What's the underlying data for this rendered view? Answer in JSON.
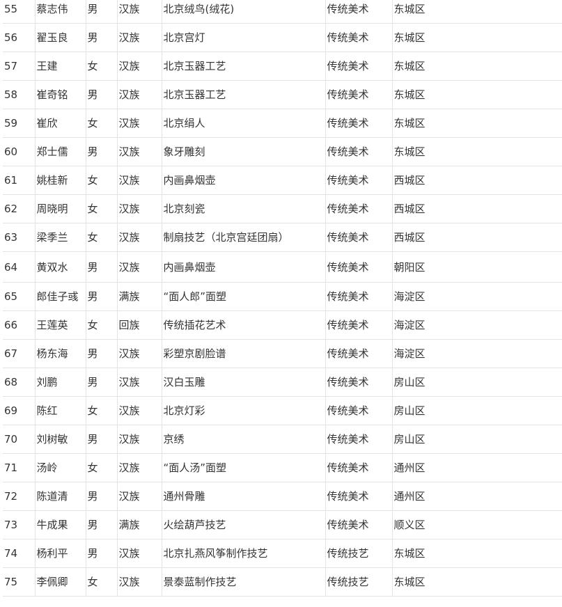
{
  "rows": [
    {
      "no": "55",
      "name": "蔡志伟",
      "gender": "男",
      "ethnic": "汉族",
      "project": "北京绒鸟(绒花)",
      "category": "传统美术",
      "district": "东城区"
    },
    {
      "no": "56",
      "name": "翟玉良",
      "gender": "男",
      "ethnic": "汉族",
      "project": "北京宫灯",
      "category": "传统美术",
      "district": "东城区"
    },
    {
      "no": "57",
      "name": "王建",
      "gender": "女",
      "ethnic": "汉族",
      "project": "北京玉器工艺",
      "category": "传统美术",
      "district": "东城区"
    },
    {
      "no": "58",
      "name": "崔奇铭",
      "gender": "男",
      "ethnic": "汉族",
      "project": "北京玉器工艺",
      "category": "传统美术",
      "district": "东城区"
    },
    {
      "no": "59",
      "name": "崔欣",
      "gender": "女",
      "ethnic": "汉族",
      "project": "北京绢人",
      "category": "传统美术",
      "district": "东城区"
    },
    {
      "no": "60",
      "name": "郑士儒",
      "gender": "男",
      "ethnic": "汉族",
      "project": "象牙雕刻",
      "category": "传统美术",
      "district": "东城区"
    },
    {
      "no": "61",
      "name": "姚桂新",
      "gender": "女",
      "ethnic": "汉族",
      "project": "内画鼻烟壶",
      "category": "传统美术",
      "district": "西城区"
    },
    {
      "no": "62",
      "name": "周晓明",
      "gender": "女",
      "ethnic": "汉族",
      "project": "北京刻瓷",
      "category": "传统美术",
      "district": "西城区"
    },
    {
      "no": "63",
      "name": "梁季兰",
      "gender": "女",
      "ethnic": "汉族",
      "project": "制扇技艺（北京宫廷团扇）",
      "category": "传统美术",
      "district": "西城区"
    },
    {
      "no": "64",
      "name": "黄双水",
      "gender": "男",
      "ethnic": "汉族",
      "project": "内画鼻烟壶",
      "category": "传统美术",
      "district": "朝阳区"
    },
    {
      "no": "65",
      "name": "郎佳子彧",
      "gender": "男",
      "ethnic": "满族",
      "project": "“面人郎”面塑",
      "category": "传统美术",
      "district": "海淀区"
    },
    {
      "no": "66",
      "name": "王莲英",
      "gender": "女",
      "ethnic": "回族",
      "project": "传统插花艺术",
      "category": "传统美术",
      "district": "海淀区"
    },
    {
      "no": "67",
      "name": "杨东海",
      "gender": "男",
      "ethnic": "汉族",
      "project": "彩塑京剧脸谱",
      "category": "传统美术",
      "district": "海淀区"
    },
    {
      "no": "68",
      "name": "刘鹏",
      "gender": "男",
      "ethnic": "汉族",
      "project": "汉白玉雕",
      "category": "传统美术",
      "district": "房山区"
    },
    {
      "no": "69",
      "name": "陈红",
      "gender": "女",
      "ethnic": "汉族",
      "project": "北京灯彩",
      "category": "传统美术",
      "district": "房山区"
    },
    {
      "no": "70",
      "name": "刘树敏",
      "gender": "男",
      "ethnic": "汉族",
      "project": "京绣",
      "category": "传统美术",
      "district": "房山区"
    },
    {
      "no": "71",
      "name": "汤岭",
      "gender": "女",
      "ethnic": "汉族",
      "project": "“面人汤”面塑",
      "category": "传统美术",
      "district": "通州区"
    },
    {
      "no": "72",
      "name": "陈道清",
      "gender": "男",
      "ethnic": "汉族",
      "project": "通州骨雕",
      "category": "传统美术",
      "district": "通州区"
    },
    {
      "no": "73",
      "name": "牛成果",
      "gender": "男",
      "ethnic": "满族",
      "project": "火绘葫芦技艺",
      "category": "传统美术",
      "district": "顺义区"
    },
    {
      "no": "74",
      "name": "杨利平",
      "gender": "男",
      "ethnic": "汉族",
      "project": "北京扎燕风筝制作技艺",
      "category": "传统技艺",
      "district": "东城区"
    },
    {
      "no": "75",
      "name": "李佩卿",
      "gender": "女",
      "ethnic": "汉族",
      "project": "景泰蓝制作技艺",
      "category": "传统技艺",
      "district": "东城区"
    }
  ]
}
